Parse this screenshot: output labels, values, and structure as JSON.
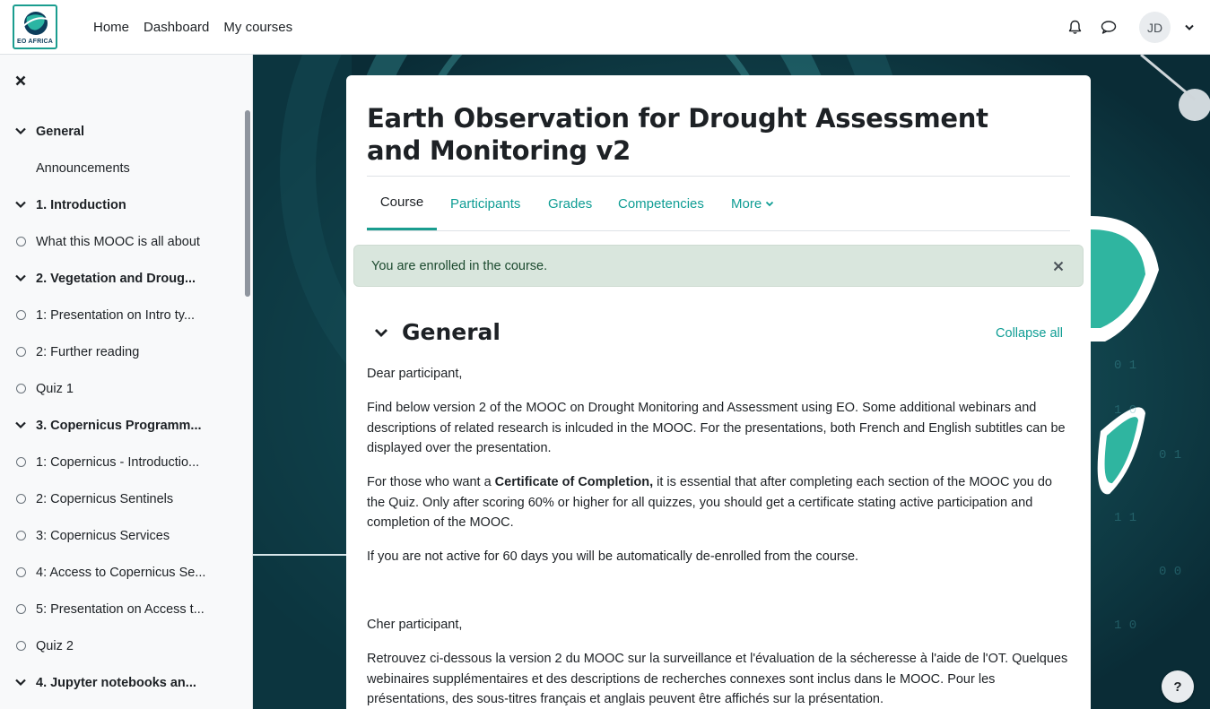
{
  "logo": {
    "text": "EO AFRICA"
  },
  "primary_nav": [
    "Home",
    "Dashboard",
    "My courses"
  ],
  "user": {
    "initials": "JD"
  },
  "course_index": [
    {
      "type": "section",
      "label": "General"
    },
    {
      "type": "item",
      "label": "Announcements",
      "no_marker": true
    },
    {
      "type": "section",
      "label": "1. Introduction"
    },
    {
      "type": "item",
      "label": "What this MOOC is all about"
    },
    {
      "type": "section",
      "label": "2. Vegetation and Droug..."
    },
    {
      "type": "item",
      "label": "1: Presentation on Intro ty..."
    },
    {
      "type": "item",
      "label": "2: Further reading"
    },
    {
      "type": "item",
      "label": "Quiz 1"
    },
    {
      "type": "section",
      "label": "3. Copernicus Programm..."
    },
    {
      "type": "item",
      "label": "1: Copernicus - Introductio..."
    },
    {
      "type": "item",
      "label": "2: Copernicus Sentinels"
    },
    {
      "type": "item",
      "label": "3: Copernicus Services"
    },
    {
      "type": "item",
      "label": "4: Access to Copernicus Se..."
    },
    {
      "type": "item",
      "label": "5: Presentation on Access t..."
    },
    {
      "type": "item",
      "label": "Quiz 2"
    },
    {
      "type": "section",
      "label": "4. Jupyter notebooks an..."
    }
  ],
  "course": {
    "title": "Earth Observation for Drought Assessment and Monitoring v2",
    "tabs": [
      "Course",
      "Participants",
      "Grades",
      "Competencies",
      "More"
    ],
    "active_tab": "Course"
  },
  "alert": {
    "text": "You are enrolled in the course."
  },
  "section": {
    "title": "General",
    "collapse_all": "Collapse all",
    "paragraphs": {
      "p1": "Dear participant,",
      "p2": "Find below version 2 of the MOOC on Drought Monitoring and Assessment using EO. Some additional webinars and descriptions of related research is inlcuded in the MOOC. For the presentations, both French and English subtitles can be displayed over the presentation.",
      "p3_before": "For those who want a ",
      "p3_bold": "Certificate of Completion,",
      "p3_after": " it is essential that after completing each section of the MOOC you do the Quiz. Only after scoring 60% or higher for all quizzes, you should get a certificate stating active participation and completion of the MOOC.",
      "p4": "If you are not active for 60 days you will be automatically de-enrolled from the course.",
      "p5": "Cher participant,",
      "p6": "Retrouvez ci-dessous la version 2 du MOOC sur la surveillance et l'évaluation de la sécheresse à l'aide de l'OT. Quelques webinaires supplémentaires et des descriptions de recherches connexes sont inclus dans le MOOC. Pour les présentations, des sous-titres français et anglais peuvent être affichés sur la présentation."
    }
  },
  "help": {
    "label": "?"
  },
  "colors": {
    "accent": "#0f9d94",
    "alert_bg": "#d9e6dd",
    "bg_dark": "#0d3b45"
  }
}
